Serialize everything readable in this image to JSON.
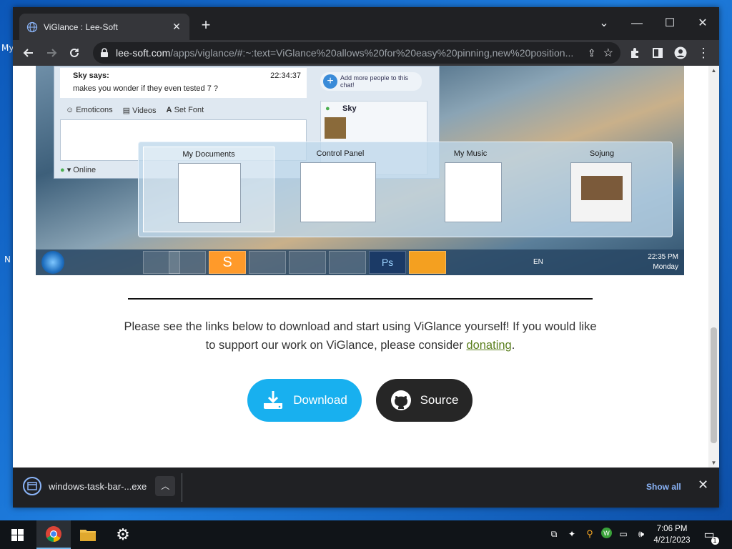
{
  "desktop": {
    "label_my": "My",
    "label_n": "N"
  },
  "browser": {
    "tab_title": "ViGlance : Lee-Soft",
    "url_host": "lee-soft.com",
    "url_rest": "/apps/viglance/#:~:text=ViGlance%20allows%20for%20easy%20pinning,new%20position..."
  },
  "screenshot": {
    "chat_sender": "Sky says:",
    "chat_time": "22:34:37",
    "chat_message": "makes you wonder if they even tested 7 ?",
    "toolbar": [
      "Emoticons",
      "Videos",
      "Set Font"
    ],
    "status": "Online",
    "add_people": "Add more people to this chat!",
    "contact": "Sky",
    "thumbnails": [
      "My Documents",
      "Control Panel",
      "My Music",
      "Sojung"
    ],
    "tray_lang": "EN",
    "tray_time": "22:35 PM",
    "tray_day": "Monday"
  },
  "page": {
    "paragraph_before": "Please see the links below to download and start using ViGlance yourself! If you would like to support our work on ViGlance, please consider ",
    "donate_link": "donating",
    "paragraph_after": ".",
    "download_label": "Download",
    "source_label": "Source"
  },
  "downloads": {
    "filename": "windows-task-bar-...exe",
    "show_all": "Show all"
  },
  "taskbar": {
    "time": "7:06 PM",
    "date": "4/21/2023",
    "notification_count": "1"
  },
  "colors": {
    "download_button": "#18b0ef",
    "source_button": "#262626",
    "link": "#5b7f1e",
    "show_all": "#8ab4f8"
  }
}
